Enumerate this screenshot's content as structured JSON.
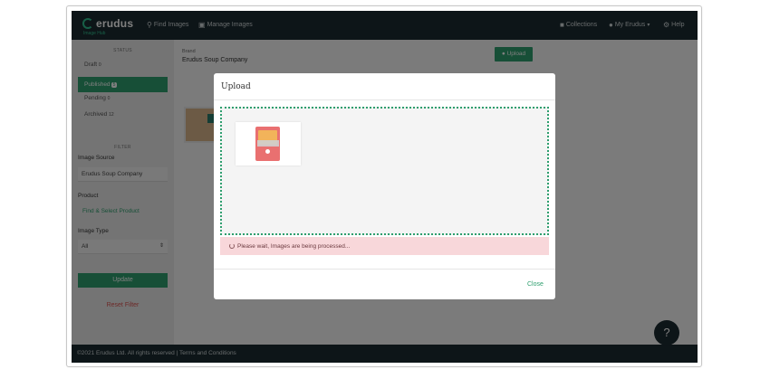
{
  "navbar": {
    "logo": "erudus",
    "logo_sub": "Image Hub",
    "find_images": "Find Images",
    "manage_images": "Manage Images",
    "collections": "Collections",
    "my_erudus": "My Erudus",
    "help": "Help"
  },
  "sidebar": {
    "status_heading": "STATUS",
    "statuses": [
      {
        "label": "Draft",
        "count": "0"
      },
      {
        "label": "Published",
        "count": "5"
      },
      {
        "label": "Pending",
        "count": "0"
      },
      {
        "label": "Archived",
        "count": "12"
      }
    ],
    "filter_heading": "FILTER",
    "image_source_label": "Image Source",
    "image_source_value": "Erudus Soup Company",
    "product_label": "Product",
    "product_link": "Find & Select Product",
    "image_type_label": "Image Type",
    "image_type_value": "All",
    "update_button": "Update",
    "reset_button": "Reset Filter"
  },
  "content": {
    "brand_label": "Brand",
    "brand_value": "Erudus Soup Company",
    "upload_button": "Upload"
  },
  "modal": {
    "title": "Upload",
    "status_message": "Please wait, Images are being processed...",
    "close_button": "Close"
  },
  "footer": {
    "copyright": "©2021 Erudus Ltd. All rights reserved | Terms and Conditions"
  },
  "help_fab": "?",
  "colors": {
    "brand_green": "#2e9e6e",
    "navbar_bg": "#1b2a30",
    "alert_bg": "#f8d7da"
  }
}
